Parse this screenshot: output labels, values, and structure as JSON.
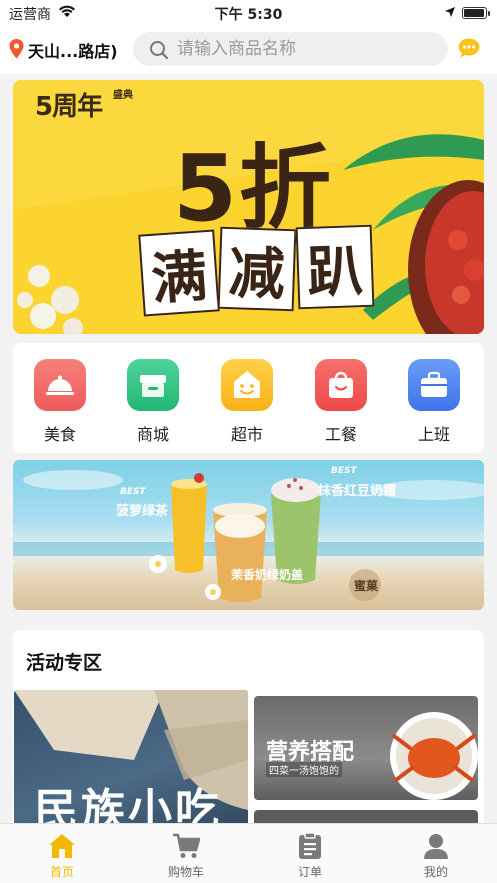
{
  "status_bar": {
    "carrier": "运营商",
    "time": "下午 5:30",
    "battery_level": 0.95
  },
  "header": {
    "store_name": "天山...路店)",
    "search_placeholder": "请输入商品名称"
  },
  "banner_main": {
    "anniversary": "5周年",
    "anniversary_sub": "盛典",
    "headline": "5折",
    "tiles": [
      "满",
      "减",
      "趴"
    ]
  },
  "categories": [
    {
      "label": "美食",
      "icon": "food-cloche-icon",
      "color": "#f26a6a"
    },
    {
      "label": "商城",
      "icon": "store-icon",
      "color": "#2fc485"
    },
    {
      "label": "超市",
      "icon": "house-smile-icon",
      "color": "#fcbb1e"
    },
    {
      "label": "工餐",
      "icon": "shopping-bag-icon",
      "color": "#f25a5a"
    },
    {
      "label": "上班",
      "icon": "briefcase-icon",
      "color": "#4f87f2"
    }
  ],
  "banner_drinks": {
    "drink1_best": "BEST",
    "drink1_name": "菠萝绿茶",
    "drink2_name": "茉香奶绿奶盖",
    "drink3_best": "BEST",
    "drink3_name": "抹香红豆奶霜",
    "brand": "蜜菓"
  },
  "activity": {
    "title": "活动专区",
    "left_card": "民族小吃",
    "right_card_title": "营养搭配",
    "right_card_sub": "四菜一汤饱饱的"
  },
  "tabbar": [
    {
      "label": "首页",
      "icon": "home-icon",
      "active": true
    },
    {
      "label": "购物车",
      "icon": "cart-icon",
      "active": false
    },
    {
      "label": "订单",
      "icon": "order-clipboard-icon",
      "active": false
    },
    {
      "label": "我的",
      "icon": "profile-icon",
      "active": false
    }
  ],
  "colors": {
    "accent": "#f5b800",
    "banner_yellow": "#fbd42f",
    "inactive_icon": "#7a7a7a"
  }
}
